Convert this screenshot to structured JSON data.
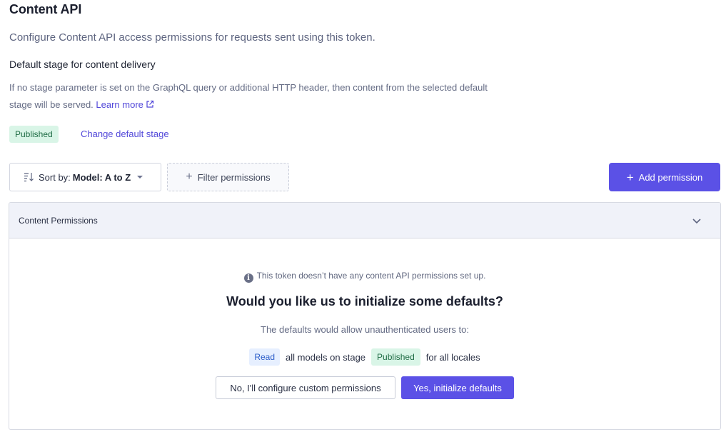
{
  "page": {
    "title": "Content API",
    "subtitle": "Configure Content API access permissions for requests sent using this token."
  },
  "default_stage": {
    "heading": "Default stage for content delivery",
    "description": "If no stage parameter is set on the GraphQL query or additional HTTP header, then content from the selected default stage will be served.",
    "learn_more": "Learn more",
    "current_stage": "Published",
    "change_label": "Change default stage"
  },
  "toolbar": {
    "sort_prefix": "Sort by:",
    "sort_value": "Model: A to Z",
    "filter_label": "Filter permissions",
    "add_label": "Add permission"
  },
  "permissions_panel": {
    "header": "Content Permissions",
    "info": "This token doesn’t have any content API permissions set up.",
    "question": "Would you like us to initialize some defaults?",
    "defaults_desc": "The defaults would allow unauthenticated users to:",
    "perm_read": "Read",
    "perm_mid": "all models on stage",
    "perm_stage": "Published",
    "perm_end": "for all locales",
    "no_button": "No, I'll configure custom permissions",
    "yes_button": "Yes, initialize defaults"
  },
  "colors": {
    "accent": "#5b51e6",
    "link": "#5147d9",
    "published_bg": "#d9f5e7",
    "published_fg": "#1d6b43",
    "read_bg": "#e6efff",
    "read_fg": "#2b5cc9",
    "panel_header_bg": "#f0f2f9"
  },
  "icons": {
    "sort": "sort-descending-icon",
    "caret": "caret-down-icon",
    "filter": "plus-icon",
    "add": "plus-icon",
    "external": "external-link-icon",
    "chevron": "chevron-down-icon",
    "info": "info-icon"
  }
}
